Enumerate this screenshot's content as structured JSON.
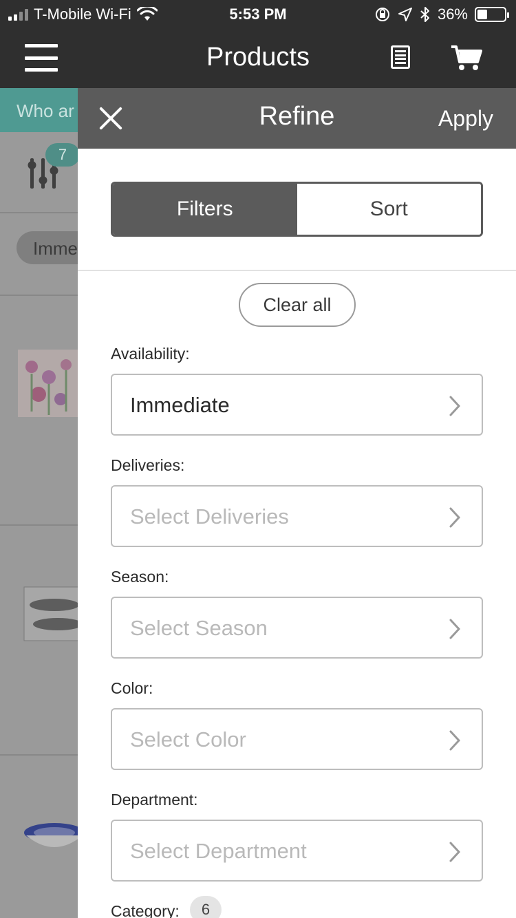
{
  "status_bar": {
    "carrier": "T-Mobile Wi-Fi",
    "time": "5:53 PM",
    "battery": "36%",
    "battery_level": 0.36
  },
  "header": {
    "title": "Products"
  },
  "background": {
    "banner_text": "Who ar",
    "filter_count": "7",
    "chip_text": "Imme"
  },
  "refine": {
    "title": "Refine",
    "apply_label": "Apply",
    "tabs": [
      {
        "label": "Filters",
        "active": true
      },
      {
        "label": "Sort",
        "active": false
      }
    ],
    "clear_all_label": "Clear all",
    "filters": [
      {
        "label": "Availability:",
        "value": "Immediate",
        "placeholder": false
      },
      {
        "label": "Deliveries:",
        "value": "Select Deliveries",
        "placeholder": true
      },
      {
        "label": "Season:",
        "value": "Select Season",
        "placeholder": true
      },
      {
        "label": "Color:",
        "value": "Select Color",
        "placeholder": true
      },
      {
        "label": "Department:",
        "value": "Select Department",
        "placeholder": true
      }
    ],
    "category": {
      "label": "Category:",
      "count": "6"
    }
  },
  "colors": {
    "header_bg": "#2f2f2f",
    "panel_header_bg": "#5b5b5b",
    "accent_teal": "#4f9a92"
  }
}
